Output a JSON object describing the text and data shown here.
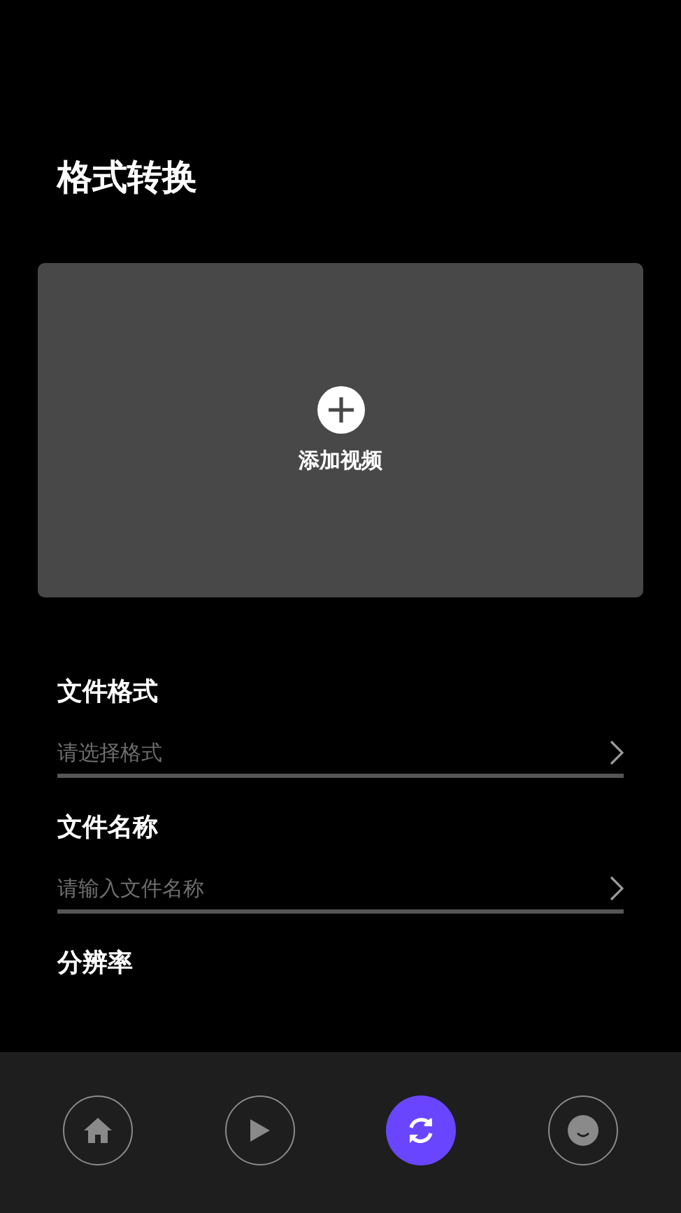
{
  "title": "格式转换",
  "upload": {
    "label": "添加视频"
  },
  "fields": [
    {
      "label": "文件格式",
      "placeholder": "请选择格式"
    },
    {
      "label": "文件名称",
      "placeholder": "请输入文件名称"
    },
    {
      "label": "分辨率"
    }
  ],
  "nav": [
    {
      "kind": "home",
      "selected": false
    },
    {
      "kind": "play",
      "selected": false
    },
    {
      "kind": "convert",
      "selected": true
    },
    {
      "kind": "profile",
      "selected": false
    }
  ]
}
